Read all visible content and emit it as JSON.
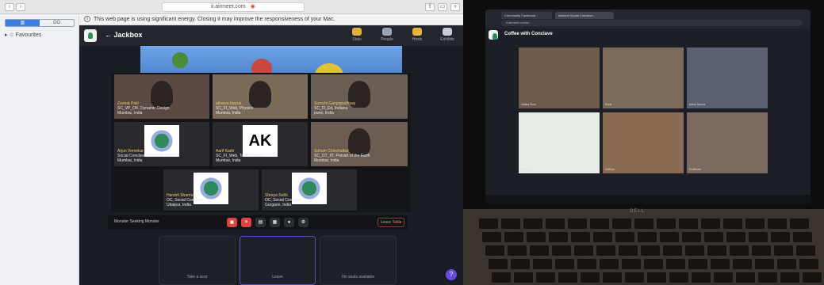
{
  "safari": {
    "url": "ii.airmeet.com",
    "nav_back": "‹",
    "nav_fwd": "›"
  },
  "sidebar": {
    "favorites": "▸ ☆ Favourites",
    "seg_left": "▥",
    "seg_right": "OO"
  },
  "warning": {
    "text": "This web page is using significant energy. Closing it may improve the responsiveness of your Mac."
  },
  "app": {
    "room_title": "← Jackbox",
    "header_icons": [
      {
        "label": "Stats",
        "color": "#e0b23a"
      },
      {
        "label": "People",
        "color": "#9aa4b2"
      },
      {
        "label": "Hosts",
        "color": "#e6b43c"
      },
      {
        "label": "Exhibits",
        "color": "#c7cdd6"
      }
    ],
    "tiles": [
      {
        "name": "Zeenat Patil",
        "sub": "SC_VP_OK, Dynamic Design",
        "loc": "Mumbai, India",
        "kind": "person",
        "bg": "#5a4a43"
      },
      {
        "name": "atharva baysie",
        "sub": "SC_FI_Web, Physics",
        "loc": "Mumbai, India",
        "kind": "person",
        "bg": "#7a6a58"
      },
      {
        "name": "Suruchi Gangopadhyay",
        "sub": "SC_FI_Ed, Indiana",
        "loc": "pune, India",
        "kind": "person",
        "bg": "#6b5f55"
      },
      {
        "name": "Arjun Vernekar",
        "sub": "Social Conclave Executive R&D",
        "loc": "Mumbai, India",
        "kind": "logo",
        "bg": "#2a2a2e"
      },
      {
        "name": "Aarif Kadri",
        "sub": "SC_FI_Web, Team Planner",
        "loc": "Mumbai, India",
        "kind": "ak",
        "bg": "#2a2a2e"
      },
      {
        "name": "Sohum Chinchalkar",
        "sub": "SC_OT_IIT, Pravah of the Earth",
        "loc": "Mumbai, India",
        "kind": "person",
        "bg": "#6c5d52"
      },
      {
        "name": "Harshit Sharma",
        "sub": "OC, Social Conclave",
        "loc": "Udaipur, India",
        "kind": "logo",
        "bg": "#2a2a2e"
      },
      {
        "name": "Shreya Sethi",
        "sub": "OC, Social Conclave",
        "loc": "Gurgaon, India",
        "kind": "conclave",
        "bg": "#2a2a2e"
      }
    ],
    "toolbar_label": "Monster Seeking Monster",
    "leave_label": "Leave Table",
    "seats": [
      "Take a seat",
      "Leave",
      "No seats available"
    ],
    "help": "?"
  },
  "photo": {
    "tab1": "Community Facebook...",
    "tab2": "Airmeet Social Conclave...",
    "address": "ii.airmeet.com/e/...",
    "room_title": "Coffee with Conclave",
    "tiles": [
      {
        "name": "Malika Pinto",
        "bg": "#6e5a4b"
      },
      {
        "name": "Rohit",
        "bg": "#7c6a5a"
      },
      {
        "name": "Aalok Nanda",
        "bg": "#5a6070"
      },
      {
        "name": "Sohil Grover",
        "bg": "#e8ece6"
      },
      {
        "name": "Adithya",
        "bg": "#8a6c55"
      },
      {
        "name": "Pratiksha",
        "bg": "#7c6a60"
      }
    ],
    "brand": "DELL"
  }
}
